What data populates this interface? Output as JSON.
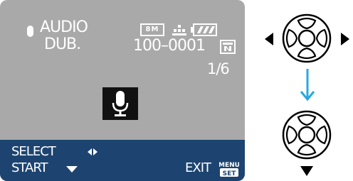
{
  "screen": {
    "title_line1": "AUDIO",
    "title_line2": "DUB.",
    "picture_size": "8M",
    "file_number": "100–0001",
    "frame_count": "1/6",
    "select_label": "SELECT",
    "start_label": "START",
    "exit_label": "EXIT",
    "menu_set_line1": "MENU",
    "menu_set_line2": "SET"
  },
  "icons": {
    "title_mic": "microphone-icon",
    "quality": "quality-icon",
    "battery": "battery-icon",
    "card": "card-icon",
    "center_mic": "microphone-icon",
    "select_arrows": "left-right-arrows-icon",
    "start_arrow": "down-arrow-icon",
    "menu_set": "menu-set-button-icon"
  },
  "controller": {
    "step1_press": "left-right",
    "step2_press": "down"
  },
  "colors": {
    "lcd_background": "#a9a9a9",
    "menu_bar": "#1d4470",
    "step_arrow": "#2aa7e0"
  }
}
